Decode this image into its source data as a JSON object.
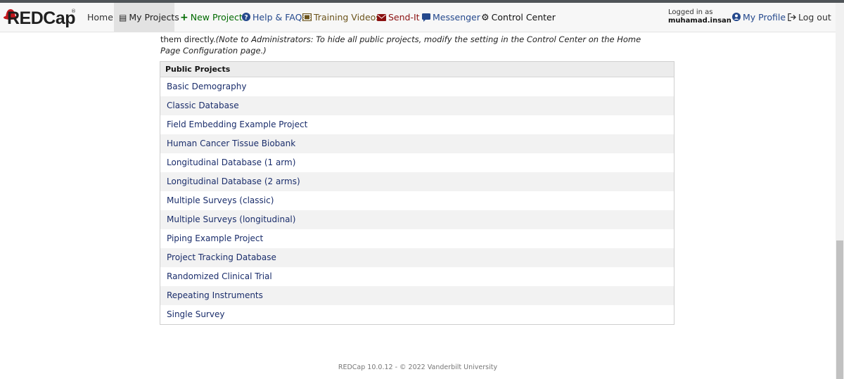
{
  "brand": {
    "logo_text": "REDCap",
    "reg_mark": "®"
  },
  "nav": {
    "home": "Home",
    "my_projects": "My Projects",
    "new_project": "New Project",
    "help": "Help & FAQ",
    "training": "Training Videos",
    "send_it": "Send-It",
    "messenger": "Messenger",
    "control_center": "Control Center",
    "logged_in_label": "Logged in as",
    "username": "muhamad.insan",
    "my_profile": "My Profile",
    "log_out": "Log out"
  },
  "notice": {
    "text": "them directly.",
    "note": "(Note to Administrators: To hide all public projects, modify the setting in the Control Center on the Home Page Configuration page.)"
  },
  "public_projects": {
    "header": "Public Projects",
    "items": [
      "Basic Demography",
      "Classic Database",
      "Field Embedding Example Project",
      "Human Cancer Tissue Biobank",
      "Longitudinal Database (1 arm)",
      "Longitudinal Database (2 arms)",
      "Multiple Surveys (classic)",
      "Multiple Surveys (longitudinal)",
      "Piping Example Project",
      "Project Tracking Database",
      "Randomized Clinical Trial",
      "Repeating Instruments",
      "Single Survey"
    ]
  },
  "footer": {
    "text": "REDCap 10.0.12 - © 2022 Vanderbilt University"
  },
  "colors": {
    "accent_red": "#c4161c",
    "link_blue": "#1a2d6b",
    "new_green": "#006a00"
  }
}
